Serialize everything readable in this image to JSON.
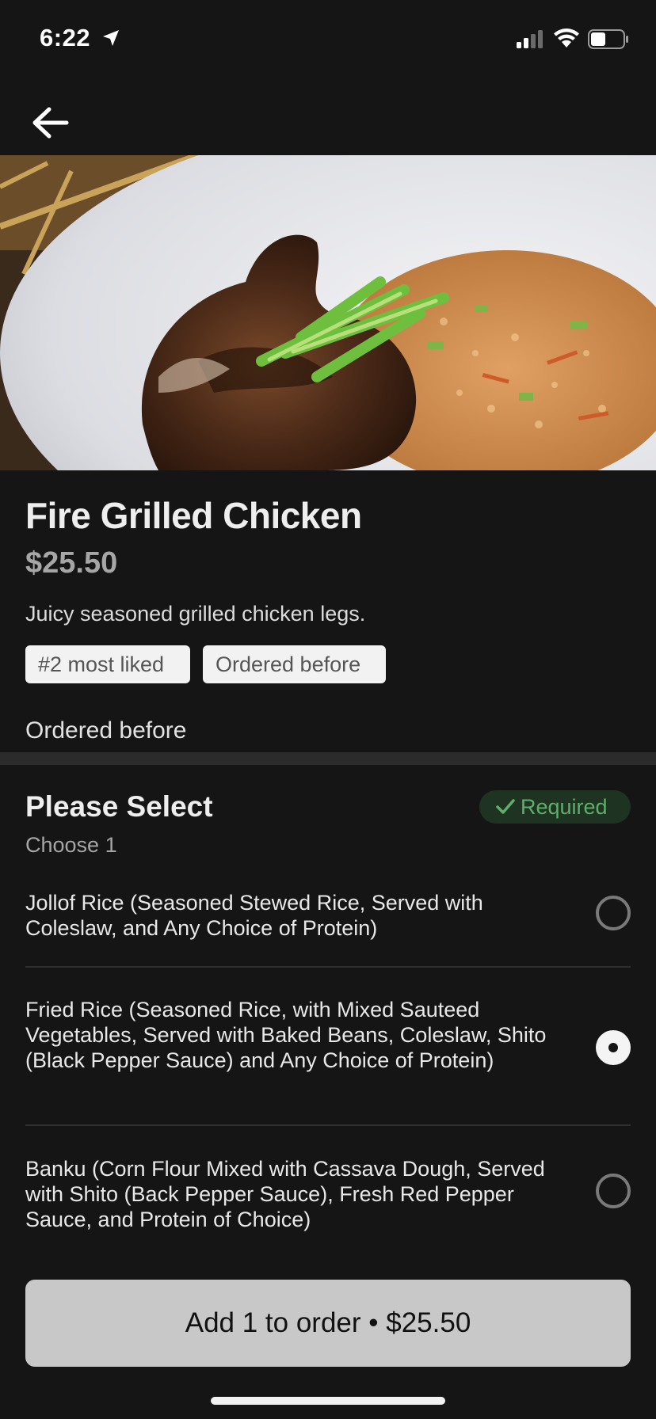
{
  "status_bar": {
    "time": "6:22",
    "icons": [
      "location-arrow-icon",
      "cellular-signal-icon",
      "wifi-icon",
      "battery-icon"
    ]
  },
  "nav": {
    "back_icon": "back-arrow-icon"
  },
  "hero": {
    "image_alt": "Fire Grilled Chicken dish photo"
  },
  "item": {
    "title": "Fire Grilled Chicken",
    "price": "$25.50",
    "description": "Juicy seasoned grilled chicken legs.",
    "badges": [
      "#2 most liked",
      "Ordered before"
    ],
    "ordered_before": "Ordered before"
  },
  "section": {
    "title": "Please Select",
    "required_label": "Required",
    "choose_text": "Choose 1",
    "options": [
      {
        "label": "Jollof Rice (Seasoned Stewed Rice, Served with Coleslaw, and Any Choice of Protein)",
        "selected": false
      },
      {
        "label": "Fried Rice (Seasoned Rice, with Mixed Sauteed Vegetables, Served with Baked Beans, Coleslaw, Shito (Black Pepper Sauce) and Any Choice of Protein)",
        "selected": true
      },
      {
        "label": "Banku (Corn Flour Mixed with Cassava Dough, Served with Shito (Back Pepper Sauce), Fresh Red Pepper Sauce, and Protein of Choice)",
        "selected": false
      }
    ]
  },
  "cta": {
    "label": "Add 1 to order • $25.50"
  },
  "colors": {
    "background": "#151515",
    "required_green": "#5fae6a",
    "button_bg": "#c8c8c8"
  }
}
